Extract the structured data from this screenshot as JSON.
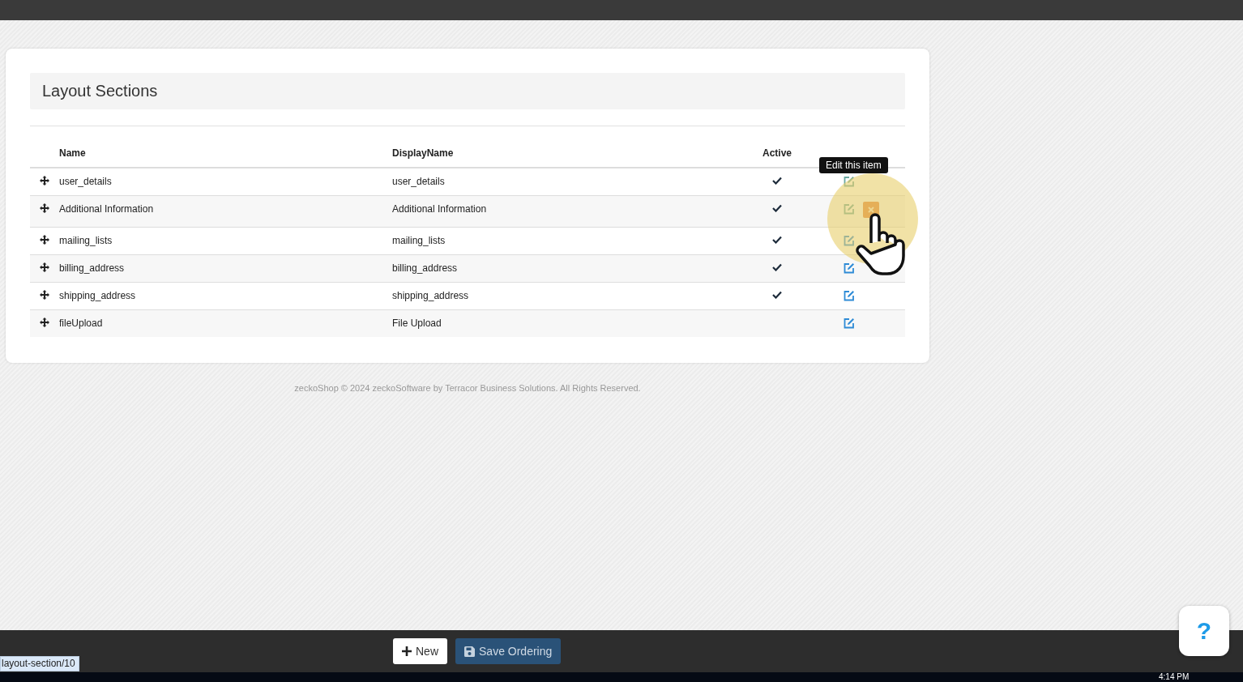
{
  "panel": {
    "title": "Layout Sections"
  },
  "table": {
    "columns": [
      "Name",
      "DisplayName",
      "Active"
    ],
    "rows": [
      {
        "name": "user_details",
        "display_name": "user_details",
        "active": true,
        "hovered": false,
        "tooltip": "Edit this item"
      },
      {
        "name": "Additional Information",
        "display_name": "Additional Information",
        "active": true,
        "hovered": true
      },
      {
        "name": "mailing_lists",
        "display_name": "mailing_lists",
        "active": true,
        "hovered": false
      },
      {
        "name": "billing_address",
        "display_name": "billing_address",
        "active": true,
        "hovered": false
      },
      {
        "name": "shipping_address",
        "display_name": "shipping_address",
        "active": true,
        "hovered": false
      },
      {
        "name": "fileUpload",
        "display_name": "File Upload",
        "active": false,
        "hovered": false
      }
    ]
  },
  "footer": "zeckoShop © 2024 zeckoSoftware by Terracor Business Solutions. All Rights Reserved.",
  "toolbar": {
    "new_label": "New",
    "save_label": "Save Ordering"
  },
  "help_button": "?",
  "status_url": "layout-section/10",
  "taskbar_time": "4:14 PM"
}
